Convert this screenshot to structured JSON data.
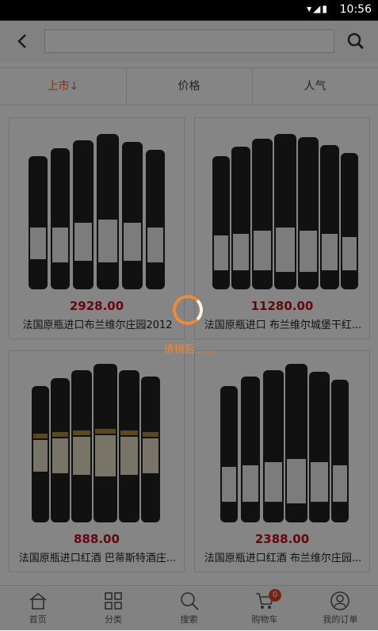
{
  "status_bar": {
    "time": "10:56"
  },
  "header": {
    "search_placeholder": ""
  },
  "sort_tabs": [
    {
      "label": "上市↓"
    },
    {
      "label": "价格"
    },
    {
      "label": "人气"
    }
  ],
  "products": [
    {
      "price": "2928.00",
      "name": "法国原瓶进口布兰维尔庄园2012"
    },
    {
      "price": "11280.00",
      "name": "法国原瓶进口 布兰维尔城堡干红..."
    },
    {
      "price": "888.00",
      "name": "法国原瓶进口红酒 巴蒂斯特酒庄..."
    },
    {
      "price": "2388.00",
      "name": "法国原瓶进口红酒 布兰维尔庄园..."
    }
  ],
  "bottom_nav": [
    {
      "label": "首页",
      "icon": "home-icon"
    },
    {
      "label": "分类",
      "icon": "category-icon"
    },
    {
      "label": "搜索",
      "icon": "search-icon"
    },
    {
      "label": "购物车",
      "icon": "cart-icon",
      "badge": "0"
    },
    {
      "label": "我的订单",
      "icon": "user-icon"
    }
  ],
  "loading": {
    "text": "请稍后......"
  },
  "colors": {
    "accent": "#f16a1b",
    "price": "#c0101b",
    "badge": "#e8442f"
  }
}
